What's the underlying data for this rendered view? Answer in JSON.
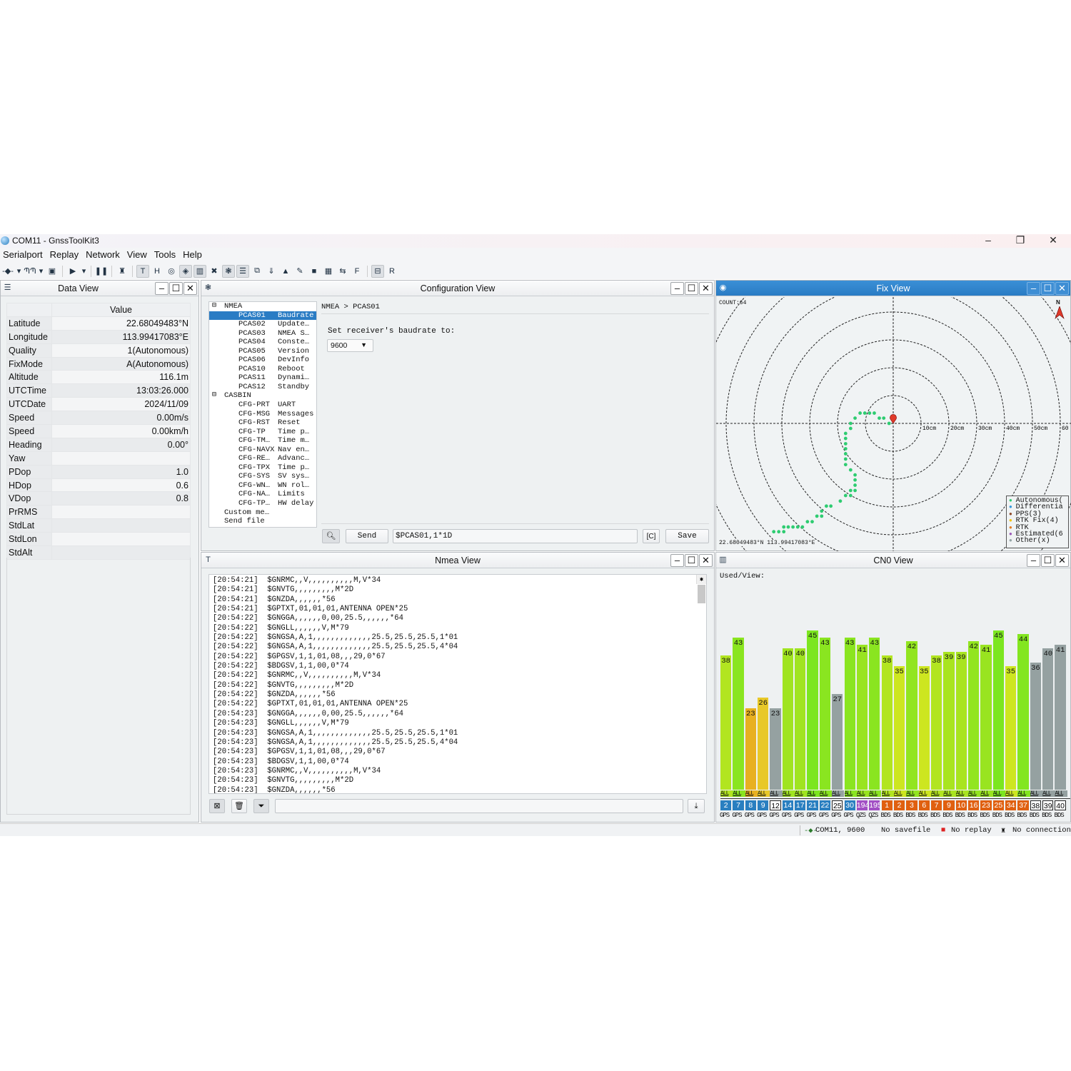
{
  "window": {
    "title": "COM11 - GnssToolKit3",
    "controls": [
      "–",
      "❐",
      "✕"
    ]
  },
  "menu": [
    "Serialport",
    "Replay",
    "Network",
    "View",
    "Tools",
    "Help"
  ],
  "toolbar": [
    {
      "icon": "serial-connect-icon",
      "glyph": "-◆-"
    },
    {
      "icon": "dropdown-icon",
      "glyph": "▾"
    },
    {
      "icon": "baudrate-icon",
      "glyph": "ՊՊ"
    },
    {
      "icon": "dropdown-icon",
      "glyph": "▾"
    },
    {
      "icon": "save-icon",
      "glyph": "▣"
    },
    {
      "sep": true
    },
    {
      "icon": "play-icon",
      "glyph": "▶"
    },
    {
      "icon": "dropdown-icon",
      "glyph": "▾"
    },
    {
      "sep": true
    },
    {
      "icon": "pause-icon",
      "glyph": "❚❚"
    },
    {
      "sep": true
    },
    {
      "icon": "network-icon",
      "glyph": "♜"
    },
    {
      "sep": true
    },
    {
      "icon": "text-view-icon",
      "glyph": "T",
      "on": true
    },
    {
      "icon": "hex-view-icon",
      "glyph": "H"
    },
    {
      "icon": "sky-view-icon",
      "glyph": "◎"
    },
    {
      "icon": "fix-view-icon",
      "glyph": "◈",
      "on": true
    },
    {
      "icon": "cn0-view-icon",
      "glyph": "▥",
      "on": true
    },
    {
      "icon": "satellite-icon",
      "glyph": "✖"
    },
    {
      "icon": "config-view-icon",
      "glyph": "❃",
      "on": true
    },
    {
      "icon": "data-view-icon",
      "glyph": "☰",
      "on": true
    },
    {
      "icon": "timing-icon",
      "glyph": "⧉"
    },
    {
      "icon": "download-icon",
      "glyph": "⇓"
    },
    {
      "icon": "compass-icon",
      "glyph": "▲"
    },
    {
      "icon": "bird-icon",
      "glyph": "✎"
    },
    {
      "icon": "map-icon",
      "glyph": "■"
    },
    {
      "icon": "calc-icon",
      "glyph": "▦"
    },
    {
      "icon": "convert-icon",
      "glyph": "⇆"
    },
    {
      "icon": "firmware-icon",
      "glyph": "F"
    },
    {
      "sep": true
    },
    {
      "icon": "layout-icon",
      "glyph": "⊟",
      "on": true
    },
    {
      "icon": "export-icon",
      "glyph": "R"
    }
  ],
  "data_view": {
    "title": "Data View",
    "header": "Value",
    "rows": [
      {
        "key": "Latitude",
        "value": "22.68049483°N"
      },
      {
        "key": "Longitude",
        "value": "113.99417083°E"
      },
      {
        "key": "Quality",
        "value": "1(Autonomous)"
      },
      {
        "key": "FixMode",
        "value": "A(Autonomous)"
      },
      {
        "key": "Altitude",
        "value": "116.1m"
      },
      {
        "key": "UTCTime",
        "value": "13:03:26.000"
      },
      {
        "key": "UTCDate",
        "value": "2024/11/09"
      },
      {
        "key": "Speed",
        "value": "0.00m/s"
      },
      {
        "key": "Speed",
        "value": "0.00km/h"
      },
      {
        "key": "Heading",
        "value": "0.00°"
      },
      {
        "key": "Yaw",
        "value": ""
      },
      {
        "key": "PDop",
        "value": "1.0"
      },
      {
        "key": "HDop",
        "value": "0.6"
      },
      {
        "key": "VDop",
        "value": "0.8"
      },
      {
        "key": "PrRMS",
        "value": ""
      },
      {
        "key": "StdLat",
        "value": ""
      },
      {
        "key": "StdLon",
        "value": ""
      },
      {
        "key": "StdAlt",
        "value": ""
      }
    ]
  },
  "config_view": {
    "title": "Configuration View",
    "tree": [
      {
        "group": "NMEA",
        "toggle": "⊟"
      },
      {
        "code": "PCAS01",
        "name": "Baudrate",
        "selected": true
      },
      {
        "code": "PCAS02",
        "name": "Update…"
      },
      {
        "code": "PCAS03",
        "name": "NMEA S…"
      },
      {
        "code": "PCAS04",
        "name": "Conste…"
      },
      {
        "code": "PCAS05",
        "name": "Version"
      },
      {
        "code": "PCAS06",
        "name": "DevInfo"
      },
      {
        "code": "PCAS10",
        "name": "Reboot"
      },
      {
        "code": "PCAS11",
        "name": "Dynami…"
      },
      {
        "code": "PCAS12",
        "name": "Standby"
      },
      {
        "group": "CASBIN",
        "toggle": "⊟"
      },
      {
        "code": "CFG-PRT",
        "name": "UART"
      },
      {
        "code": "CFG-MSG",
        "name": "Messages"
      },
      {
        "code": "CFG-RST",
        "name": "Reset"
      },
      {
        "code": "CFG-TP",
        "name": "Time p…"
      },
      {
        "code": "CFG-TM…",
        "name": "Time m…"
      },
      {
        "code": "CFG-NAVX",
        "name": "Nav en…"
      },
      {
        "code": "CFG-RE…",
        "name": "Advanc…"
      },
      {
        "code": "CFG-TPX",
        "name": "Time p…"
      },
      {
        "code": "CFG-SYS",
        "name": "SV sys…"
      },
      {
        "code": "CFG-WN…",
        "name": "WN rol…"
      },
      {
        "code": "CFG-NA…",
        "name": "Limits"
      },
      {
        "code": "CFG-TP…",
        "name": "HW delay"
      },
      {
        "top": "Custom me…"
      },
      {
        "top": "Send file"
      }
    ],
    "breadcrumb": "NMEA > PCAS01",
    "prompt": "Set receiver's baudrate to:",
    "baudrate_selected": "9600",
    "send_label": "Send",
    "command_value": "$PCAS01,1*1D",
    "save_label": "Save"
  },
  "fix_view": {
    "title": "Fix View",
    "count": "COUNT:64",
    "position": "22.68049483°N 113.99417083°E",
    "north_label": "N",
    "ring_labels": [
      "10cm",
      "20cm",
      "30cm",
      "40cm",
      "50cm",
      "60"
    ],
    "legend": [
      {
        "label": "Autonomous(",
        "color": "#2ecc71"
      },
      {
        "label": "Differentia",
        "color": "#3498db"
      },
      {
        "label": "PPS(3)",
        "color": "#8e4a2a"
      },
      {
        "label": "RTK Fix(4)",
        "color": "#f1c40f"
      },
      {
        "label": "RTK",
        "color": "#e67e22"
      },
      {
        "label": "Estimated(6",
        "color": "#9b59b6"
      },
      {
        "label": "Other(x)",
        "color": "#95a5a6"
      }
    ],
    "point_color": "#2ecc71",
    "points_cm": [
      [
        -1.5,
        0
      ],
      [
        -3.4,
        1.9
      ],
      [
        -5.0,
        1.9
      ],
      [
        -6.8,
        3.7
      ],
      [
        -8.5,
        3.7
      ],
      [
        -10.2,
        3.7
      ],
      [
        -11.9,
        3.7
      ],
      [
        -13.7,
        1.9
      ],
      [
        -15.3,
        0
      ],
      [
        -15.3,
        -1.8
      ],
      [
        -17.1,
        -3.6
      ],
      [
        -17.1,
        -5.4
      ],
      [
        -17.1,
        -7.3
      ],
      [
        -17.1,
        -9.1
      ],
      [
        -17.1,
        -10.9
      ],
      [
        -17.1,
        -12.8
      ],
      [
        -17.1,
        -14.8
      ],
      [
        -15.3,
        -16.7
      ],
      [
        -13.7,
        -18.5
      ],
      [
        -13.7,
        -20.3
      ],
      [
        -13.7,
        -22.2
      ],
      [
        -13.7,
        -24.1
      ],
      [
        -15.3,
        -24.1
      ],
      [
        -15.3,
        -25.9
      ],
      [
        -17.1,
        -25.9
      ],
      [
        -19.0,
        -27.9
      ],
      [
        -22.4,
        -29.7
      ],
      [
        -24.0,
        -29.7
      ],
      [
        -25.7,
        -31.5
      ],
      [
        -25.7,
        -33.3
      ],
      [
        -27.4,
        -33.3
      ],
      [
        -29.1,
        -35.3
      ],
      [
        -30.8,
        -35.3
      ],
      [
        -32.6,
        -37.2
      ],
      [
        -34.3,
        -37.2
      ],
      [
        -36.0,
        -37.2
      ],
      [
        -37.7,
        -37.2
      ],
      [
        -39.3,
        -37.2
      ],
      [
        -39.3,
        -38.9
      ],
      [
        -41.1,
        -38.9
      ],
      [
        -42.9,
        -38.9
      ]
    ]
  },
  "nmea_view": {
    "title": "Nmea View",
    "lines": [
      "[20:54:21]  $GNRMC,,V,,,,,,,,,,M,V*34",
      "[20:54:21]  $GNVTG,,,,,,,,,M*2D",
      "[20:54:21]  $GNZDA,,,,,,*56",
      "[20:54:21]  $GPTXT,01,01,01,ANTENNA OPEN*25",
      "[20:54:22]  $GNGGA,,,,,,0,00,25.5,,,,,,*64",
      "[20:54:22]  $GNGLL,,,,,,V,M*79",
      "[20:54:22]  $GNGSA,A,1,,,,,,,,,,,,,25.5,25.5,25.5,1*01",
      "[20:54:22]  $GNGSA,A,1,,,,,,,,,,,,,25.5,25.5,25.5,4*04",
      "[20:54:22]  $GPGSV,1,1,01,08,,,29,0*67",
      "[20:54:22]  $BDGSV,1,1,00,0*74",
      "[20:54:22]  $GNRMC,,V,,,,,,,,,,M,V*34",
      "[20:54:22]  $GNVTG,,,,,,,,,M*2D",
      "[20:54:22]  $GNZDA,,,,,,*56",
      "[20:54:22]  $GPTXT,01,01,01,ANTENNA OPEN*25",
      "[20:54:23]  $GNGGA,,,,,,0,00,25.5,,,,,,*64",
      "[20:54:23]  $GNGLL,,,,,,V,M*79",
      "[20:54:23]  $GNGSA,A,1,,,,,,,,,,,,,25.5,25.5,25.5,1*01",
      "[20:54:23]  $GNGSA,A,1,,,,,,,,,,,,,25.5,25.5,25.5,4*04",
      "[20:54:23]  $GPGSV,1,1,01,08,,,29,0*67",
      "[20:54:23]  $BDGSV,1,1,00,0*74",
      "[20:54:23]  $GNRMC,,V,,,,,,,,,,M,V*34",
      "[20:54:23]  $GNVTG,,,,,,,,,M*2D",
      "[20:54:23]  $GNZDA,,,,,,*56"
    ],
    "filter_value": ""
  },
  "cn0_view": {
    "title": "CN0 View",
    "label": "Used/View:",
    "band_label": "ALL",
    "system_colors": {
      "GPS": "#2a7fc0",
      "QZS": "#a24fc4",
      "BDS": "#e06010",
      "unused": "#95a1a1"
    },
    "satellites": [
      {
        "prn": "2",
        "sys": "GPS",
        "cn0": 38,
        "used": true
      },
      {
        "prn": "7",
        "sys": "GPS",
        "cn0": 43,
        "used": true
      },
      {
        "prn": "8",
        "sys": "GPS",
        "cn0": 23,
        "used": true
      },
      {
        "prn": "9",
        "sys": "GPS",
        "cn0": 26,
        "used": true
      },
      {
        "prn": "12",
        "sys": "GPS",
        "cn0": 23,
        "used": false
      },
      {
        "prn": "14",
        "sys": "GPS",
        "cn0": 40,
        "used": true
      },
      {
        "prn": "17",
        "sys": "GPS",
        "cn0": 40,
        "used": true
      },
      {
        "prn": "21",
        "sys": "GPS",
        "cn0": 45,
        "used": true
      },
      {
        "prn": "22",
        "sys": "GPS",
        "cn0": 43,
        "used": true
      },
      {
        "prn": "25",
        "sys": "GPS",
        "cn0": 27,
        "used": false
      },
      {
        "prn": "30",
        "sys": "GPS",
        "cn0": 43,
        "used": true
      },
      {
        "prn": "194",
        "sys": "QZS",
        "cn0": 41,
        "used": true
      },
      {
        "prn": "195",
        "sys": "QZS",
        "cn0": 43,
        "used": true
      },
      {
        "prn": "1",
        "sys": "BDS",
        "cn0": 38,
        "used": true
      },
      {
        "prn": "2",
        "sys": "BDS",
        "cn0": 35,
        "used": true
      },
      {
        "prn": "3",
        "sys": "BDS",
        "cn0": 42,
        "used": true
      },
      {
        "prn": "6",
        "sys": "BDS",
        "cn0": 35,
        "used": true
      },
      {
        "prn": "7",
        "sys": "BDS",
        "cn0": 38,
        "used": true
      },
      {
        "prn": "9",
        "sys": "BDS",
        "cn0": 39,
        "used": true
      },
      {
        "prn": "10",
        "sys": "BDS",
        "cn0": 39,
        "used": true
      },
      {
        "prn": "16",
        "sys": "BDS",
        "cn0": 42,
        "used": true
      },
      {
        "prn": "23",
        "sys": "BDS",
        "cn0": 41,
        "used": true
      },
      {
        "prn": "25",
        "sys": "BDS",
        "cn0": 45,
        "used": true
      },
      {
        "prn": "34",
        "sys": "BDS",
        "cn0": 35,
        "used": true
      },
      {
        "prn": "37",
        "sys": "BDS",
        "cn0": 44,
        "used": true
      },
      {
        "prn": "38",
        "sys": "BDS",
        "cn0": 36,
        "used": false
      },
      {
        "prn": "39",
        "sys": "BDS",
        "cn0": 40,
        "used": false
      },
      {
        "prn": "40",
        "sys": "BDS",
        "cn0": 41,
        "used": false
      }
    ]
  },
  "status_bar": {
    "port": "COM11, 9600",
    "savefile": "No savefile",
    "replay": "No replay",
    "connection": "No connection"
  }
}
